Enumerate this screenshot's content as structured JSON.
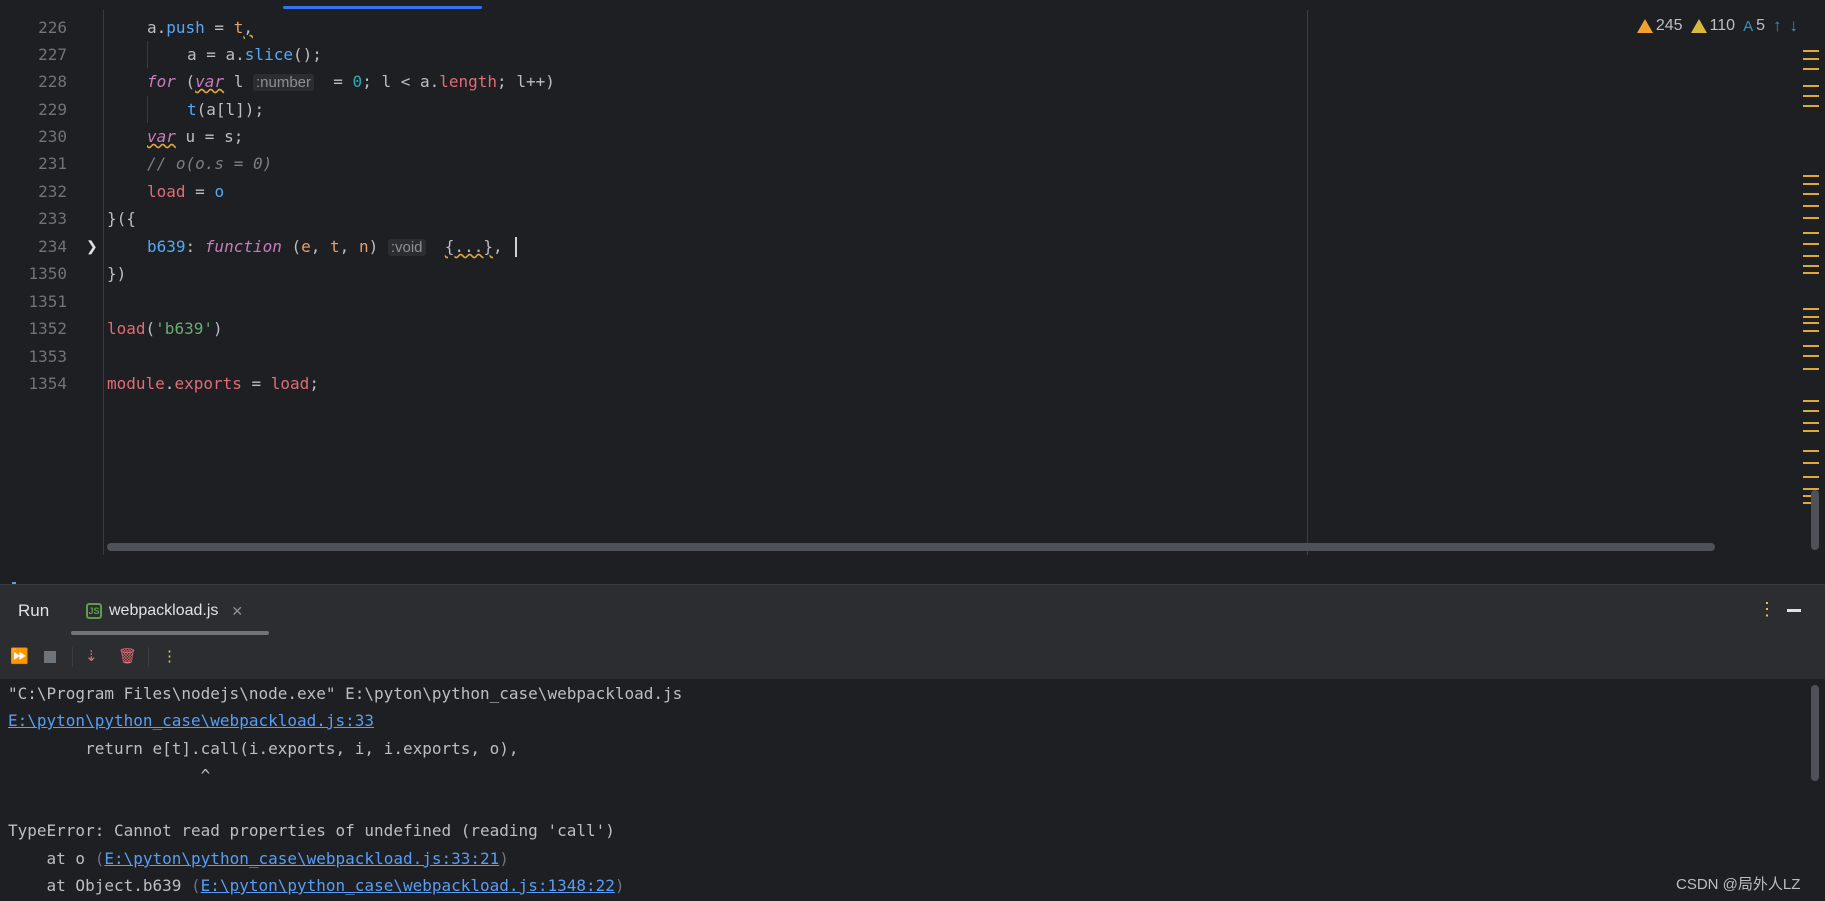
{
  "editor": {
    "lines": [
      {
        "n": "226",
        "indent": 1,
        "tokens": [
          [
            "a.",
            ""
          ],
          [
            "push",
            "fn"
          ],
          [
            " = ",
            ""
          ],
          [
            "t",
            "orange"
          ],
          [
            ",",
            "wavy"
          ]
        ]
      },
      {
        "n": "227",
        "indent": 2,
        "tokens": [
          [
            "a = a.",
            ""
          ],
          [
            "slice",
            "fn"
          ],
          [
            "();",
            ""
          ]
        ]
      },
      {
        "n": "228",
        "indent": 1,
        "tokens": [
          [
            "for",
            "kw2"
          ],
          [
            " (",
            ""
          ],
          [
            "var",
            "kw2 wavy"
          ],
          [
            " l ",
            ""
          ],
          [
            ":number",
            "hint"
          ],
          [
            "  = ",
            ""
          ],
          [
            "0",
            "num"
          ],
          [
            "; l < a.",
            ""
          ],
          [
            "length",
            "red"
          ],
          [
            "; l++)",
            ""
          ]
        ]
      },
      {
        "n": "229",
        "indent": 2,
        "tokens": [
          [
            "t",
            "fn"
          ],
          [
            "(a[l]);",
            ""
          ]
        ]
      },
      {
        "n": "230",
        "indent": 1,
        "tokens": [
          [
            "var",
            "kw2 wavy"
          ],
          [
            " u = s;",
            ""
          ]
        ]
      },
      {
        "n": "231",
        "indent": 1,
        "tokens": [
          [
            "// o(o.s = 0)",
            "cmt"
          ]
        ]
      },
      {
        "n": "232",
        "indent": 1,
        "tokens": [
          [
            "load",
            "red"
          ],
          [
            " = ",
            ""
          ],
          [
            "o",
            "fn"
          ]
        ]
      },
      {
        "n": "233",
        "indent": 0,
        "tokens": [
          [
            "}({",
            ""
          ]
        ]
      },
      {
        "n": "234",
        "indent": 1,
        "tokens": [
          [
            "b639",
            "fn"
          ],
          [
            ": ",
            ""
          ],
          [
            "function",
            "kw2"
          ],
          [
            " (",
            ""
          ],
          [
            "e",
            "orange"
          ],
          [
            ", ",
            ""
          ],
          [
            "t",
            "orange"
          ],
          [
            ", ",
            ""
          ],
          [
            "n",
            "orange"
          ],
          [
            ") ",
            ""
          ],
          [
            ":void",
            "hint"
          ],
          [
            "  ",
            ""
          ],
          [
            "{...}",
            "fold"
          ],
          [
            ",",
            ""
          ]
        ]
      },
      {
        "n": "1350",
        "indent": 0,
        "tokens": [
          [
            "})",
            ""
          ]
        ]
      },
      {
        "n": "1351",
        "indent": 0,
        "tokens": [
          [
            "",
            ""
          ]
        ]
      },
      {
        "n": "1352",
        "indent": 0,
        "tokens": [
          [
            "load",
            "red"
          ],
          [
            "(",
            ""
          ],
          [
            "'b639'",
            "str"
          ],
          [
            ")",
            ""
          ]
        ]
      },
      {
        "n": "1353",
        "indent": 0,
        "tokens": [
          [
            "",
            ""
          ]
        ]
      },
      {
        "n": "1354",
        "indent": 0,
        "tokens": [
          [
            "module",
            "red"
          ],
          [
            ".",
            ""
          ],
          [
            "exports",
            "red"
          ],
          [
            " = ",
            ""
          ],
          [
            "load",
            "red"
          ],
          [
            ";",
            ""
          ]
        ]
      }
    ],
    "inspections": {
      "errors": "245",
      "warnings": "110",
      "typos": "5"
    }
  },
  "run_panel": {
    "title": "Run",
    "tab_label": "webpackload.js",
    "tab_icon": "JS",
    "console_lines": [
      {
        "parts": [
          [
            "\"C:\\Program Files\\nodejs\\node.exe\" E:\\pyton\\python_case\\webpackload.js",
            ""
          ]
        ]
      },
      {
        "parts": [
          [
            "E:\\pyton\\python_case\\webpackload.js:33",
            "link"
          ]
        ]
      },
      {
        "parts": [
          [
            "        return e[t].call(i.exports, i, i.exports, o),",
            ""
          ]
        ]
      },
      {
        "parts": [
          [
            "                    ^",
            ""
          ]
        ]
      },
      {
        "parts": [
          [
            "",
            ""
          ]
        ]
      },
      {
        "parts": [
          [
            "TypeError: Cannot read properties of undefined (reading 'call')",
            ""
          ]
        ]
      },
      {
        "parts": [
          [
            "    at o ",
            ""
          ],
          [
            "(",
            "paren"
          ],
          [
            "E:\\pyton\\python_case\\webpackload.js:33:21",
            "link"
          ],
          [
            ")",
            "paren"
          ]
        ]
      },
      {
        "parts": [
          [
            "    at Object.b639 ",
            ""
          ],
          [
            "(",
            "paren"
          ],
          [
            "E:\\pyton\\python_case\\webpackload.js:1348:22",
            "link"
          ],
          [
            ")",
            "paren"
          ]
        ]
      }
    ]
  },
  "watermark": "CSDN @局外人LZ",
  "colors": {
    "accent": "#3574f0",
    "link": "#589df6",
    "warning": "#f2a12c"
  }
}
